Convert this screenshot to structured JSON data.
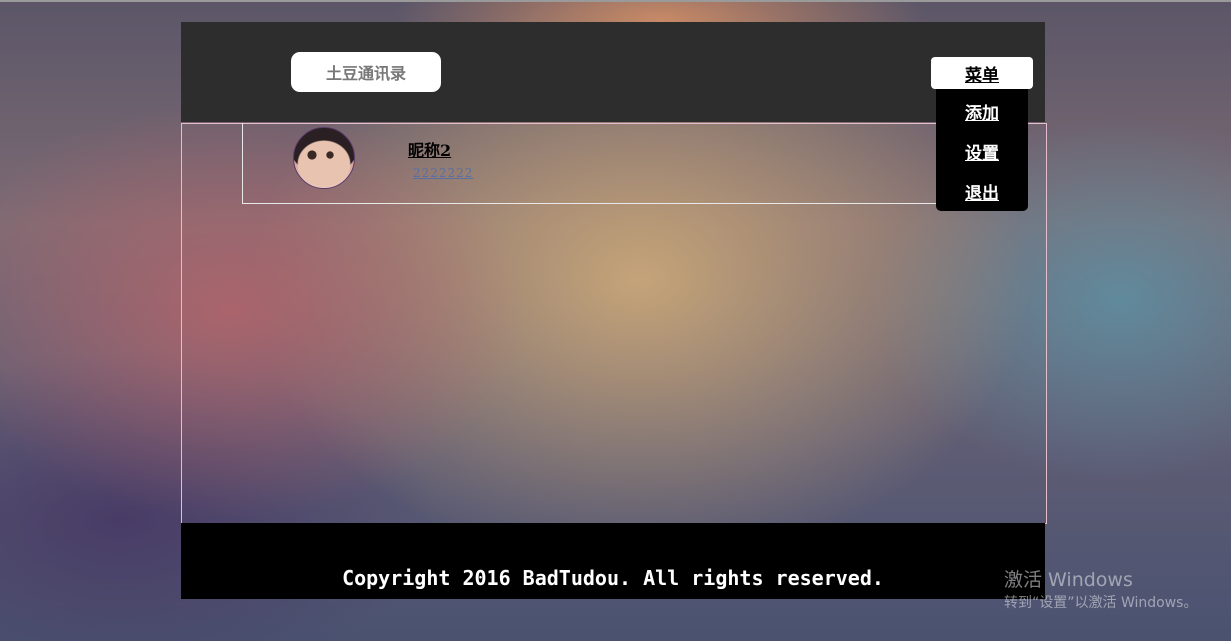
{
  "header": {
    "logo_label": "土豆通讯录",
    "menu_label": "菜单"
  },
  "menu": {
    "items": [
      {
        "label": "添加"
      },
      {
        "label": "设置"
      },
      {
        "label": "退出"
      }
    ]
  },
  "contacts": [
    {
      "nickname": "昵称2",
      "phone": "2222222"
    }
  ],
  "footer": {
    "copyright": "Copyright 2016 BadTudou. All rights reserved."
  },
  "watermark": {
    "title": "激活 Windows",
    "subtitle": "转到“设置”以激活 Windows。"
  }
}
